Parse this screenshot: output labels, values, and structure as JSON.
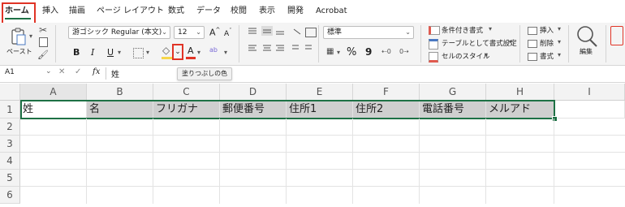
{
  "ribbon_tabs": [
    "ホーム",
    "挿入",
    "描画",
    "ページ レイアウト",
    "数式",
    "データ",
    "校閲",
    "表示",
    "開発",
    "Acrobat"
  ],
  "ribbon": {
    "paste_label": "ペースト",
    "font_name": "游ゴシック Regular (本文)",
    "font_size": "12",
    "grow_font": "A",
    "shrink_font": "A",
    "bold": "B",
    "italic": "I",
    "underline": "U",
    "font_color_letter": "A",
    "number_format": "標準",
    "percent": "%",
    "comma": "9",
    "conditional_format": "条件付き書式",
    "format_as_table": "テーブルとして書式設定",
    "cell_styles": "セルのスタイル",
    "insert": "挿入",
    "delete": "削除",
    "format": "書式",
    "edit": "編集",
    "fill_color_hex": "#f6d64a",
    "font_color_hex": "#e03426",
    "highlight_hex": "#e03426"
  },
  "formula_bar": {
    "name_box": "A1",
    "fx": "fx",
    "content": "姓"
  },
  "tooltip": "塗りつぶしの色",
  "columns": [
    "A",
    "B",
    "C",
    "D",
    "E",
    "F",
    "G",
    "H",
    "I"
  ],
  "rows": [
    "1",
    "2",
    "3",
    "4",
    "5",
    "6"
  ],
  "row1": [
    "姓",
    "名",
    "フリガナ",
    "郵便番号",
    "住所1",
    "住所2",
    "電話番号",
    "メルアド"
  ]
}
